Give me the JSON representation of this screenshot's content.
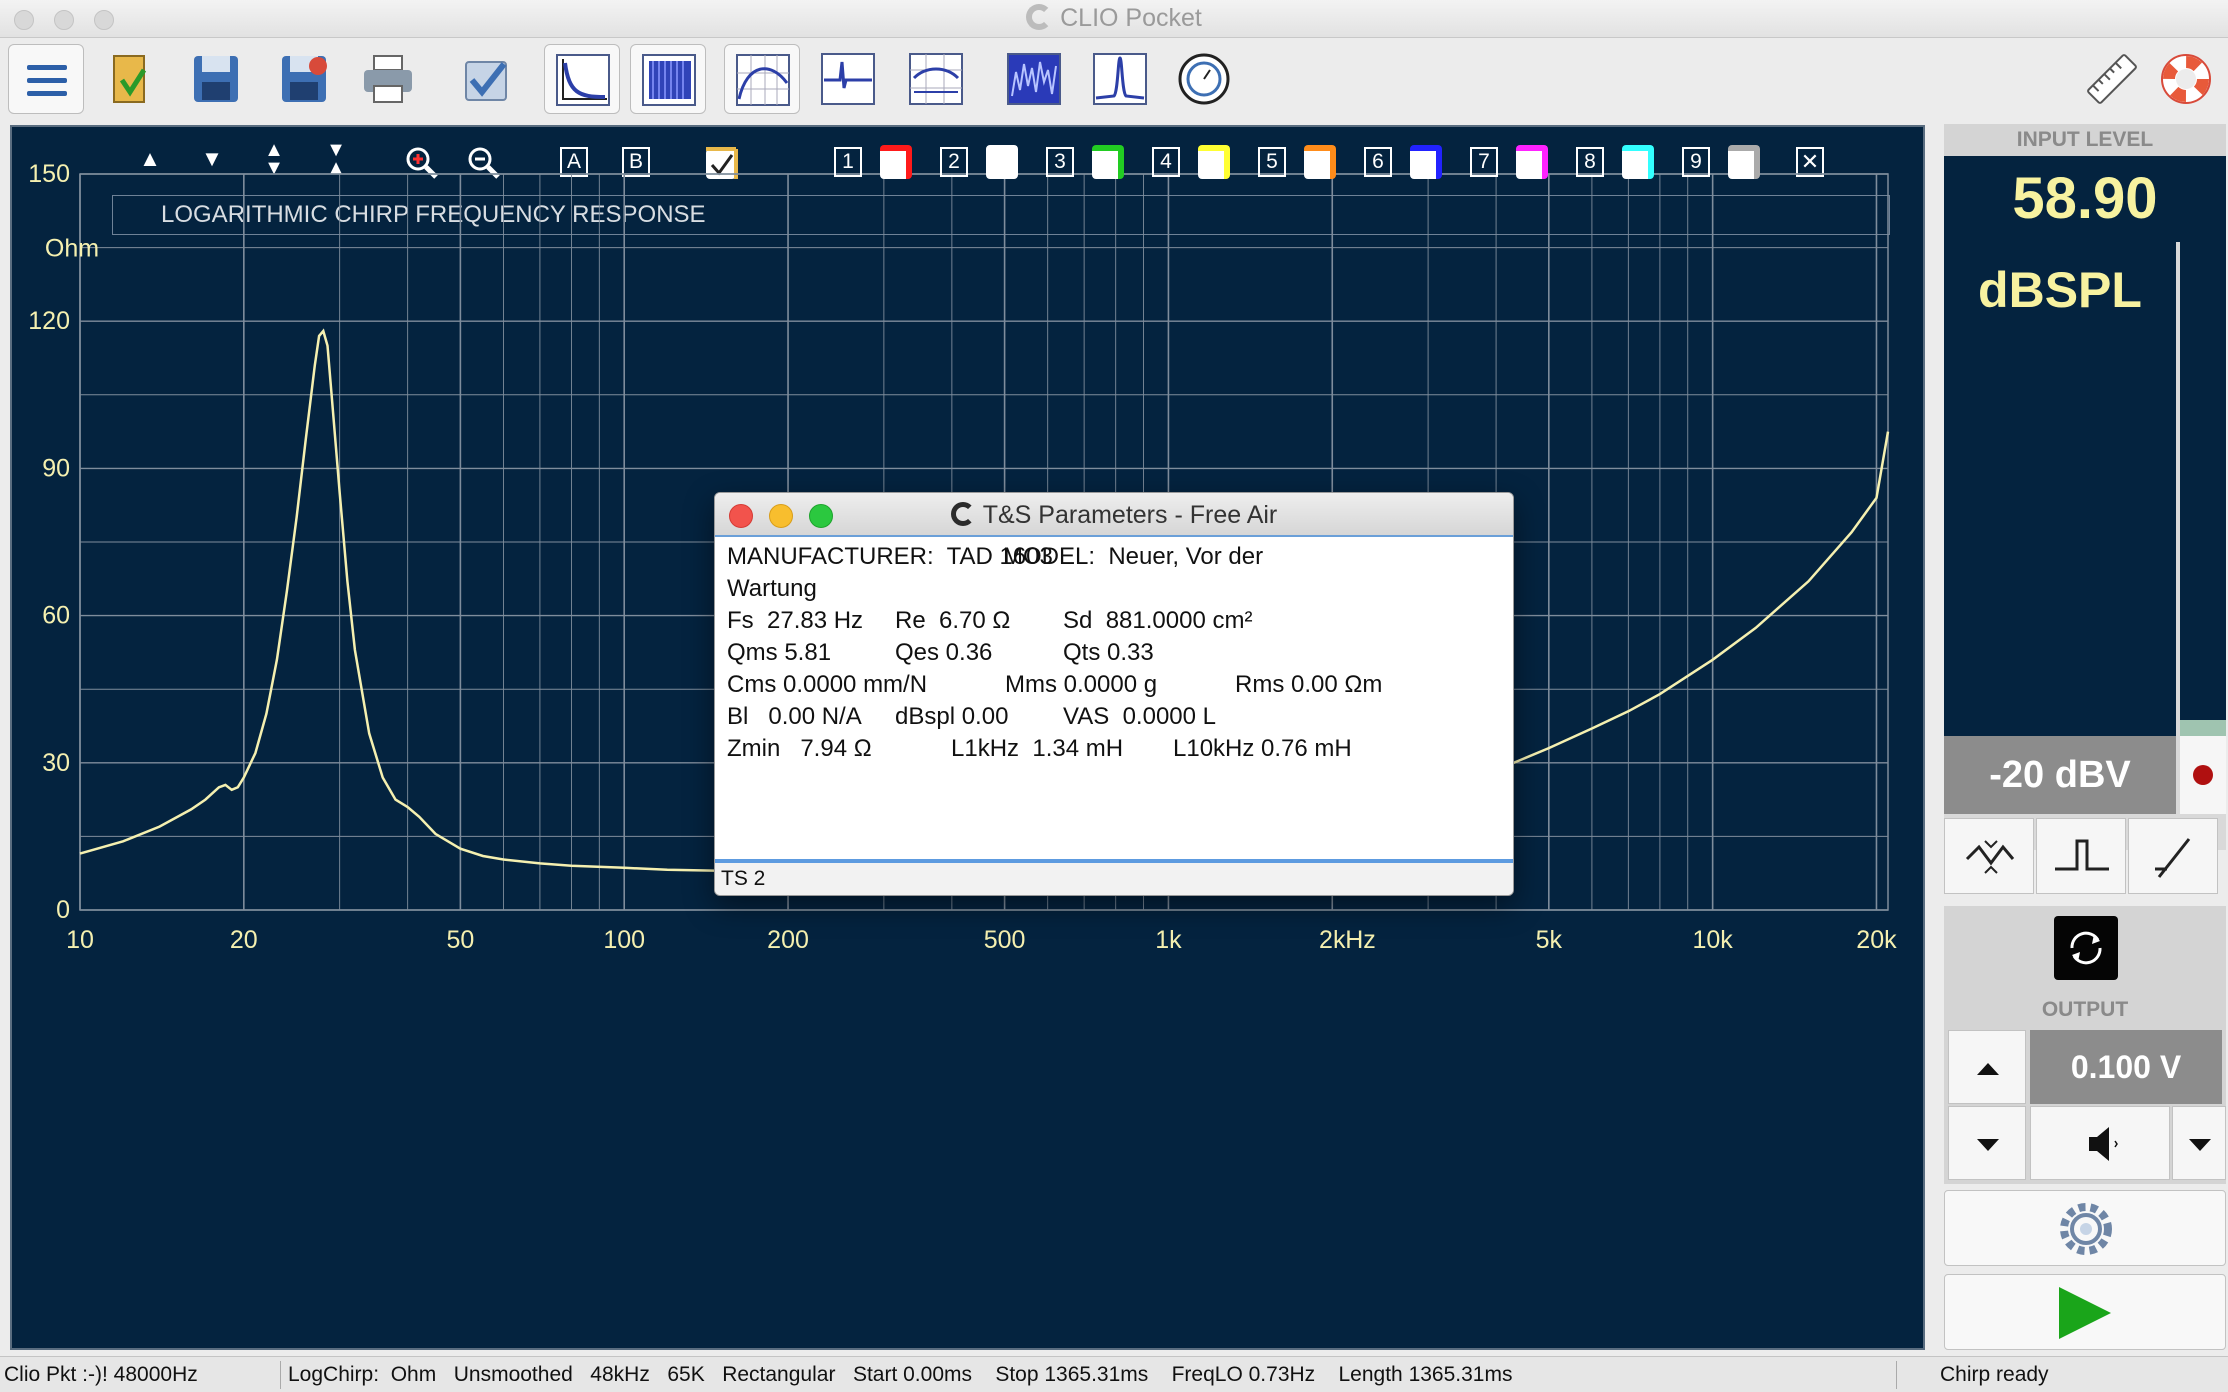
{
  "window": {
    "title": "CLIO Pocket"
  },
  "toolbar": {
    "icons": [
      "menu-icon",
      "open-file-icon",
      "save-icon",
      "save-as-icon",
      "print-icon",
      "checklist-icon",
      "chirp-response-icon",
      "waterfall-icon",
      "frequency-response-icon",
      "impulse-icon",
      "scope-icon",
      "spectrogram-icon",
      "narrow-peak-icon",
      "meter-dial-icon",
      "ruler-icon",
      "help-lifebuoy-icon"
    ]
  },
  "graph": {
    "tools": {
      "a_label": "A",
      "b_label": "B",
      "close_label": "✕"
    },
    "overlays": [
      {
        "num": "1",
        "color": "#ff1a1a"
      },
      {
        "num": "2",
        "color": "#ffffff"
      },
      {
        "num": "3",
        "color": "#22cc22"
      },
      {
        "num": "4",
        "color": "#ffff33"
      },
      {
        "num": "5",
        "color": "#ff8c1a"
      },
      {
        "num": "6",
        "color": "#2222ff"
      },
      {
        "num": "7",
        "color": "#ff22ff"
      },
      {
        "num": "8",
        "color": "#33ffff"
      },
      {
        "num": "9",
        "color": "#aaaaaa"
      }
    ],
    "colors": {
      "background": "#04233f",
      "grid": "#7f8d9c",
      "curve": "#f5f0b0",
      "tick_text": "#f5f0b0"
    }
  },
  "chart_data": {
    "type": "line",
    "title": "LOGARITHMIC CHIRP FREQUENCY RESPONSE",
    "xlabel": "Hz",
    "ylabel": "Ohm",
    "xscale": "log",
    "xlim": [
      10,
      21000
    ],
    "ylim": [
      0,
      150
    ],
    "x_ticks": [
      {
        "v": 10,
        "label": "10"
      },
      {
        "v": 20,
        "label": "20"
      },
      {
        "v": 50,
        "label": "50"
      },
      {
        "v": 100,
        "label": "100"
      },
      {
        "v": 200,
        "label": "200"
      },
      {
        "v": 500,
        "label": "500"
      },
      {
        "v": 1000,
        "label": "1k"
      },
      {
        "v": 2000,
        "label": "2k"
      },
      {
        "v": 5000,
        "label": "5k"
      },
      {
        "v": 10000,
        "label": "10k"
      },
      {
        "v": 20000,
        "label": "20k"
      }
    ],
    "y_ticks": [
      {
        "v": 0,
        "label": "0"
      },
      {
        "v": 30,
        "label": "30"
      },
      {
        "v": 60,
        "label": "60"
      },
      {
        "v": 90,
        "label": "90"
      },
      {
        "v": 120,
        "label": "120"
      },
      {
        "v": 150,
        "label": "150"
      }
    ],
    "grid": true,
    "series": [
      {
        "x": [
          10,
          12,
          14,
          16,
          17,
          18,
          18.5,
          19,
          19.5,
          20,
          21,
          22,
          23,
          24,
          25,
          26,
          27,
          27.5,
          28,
          28.5,
          29,
          30,
          31,
          32,
          34,
          36,
          38,
          40,
          42,
          45,
          50,
          55,
          60,
          70,
          80,
          100,
          120,
          150,
          200,
          250,
          300,
          400,
          500,
          600,
          700,
          800,
          1000,
          1200,
          1500,
          2000,
          2500,
          3000,
          4000,
          5000,
          6000,
          7000,
          8000,
          10000,
          12000,
          15000,
          18000,
          20000,
          21000
        ],
        "y": [
          11.5,
          14,
          17,
          20.5,
          22.5,
          25,
          25.5,
          24.5,
          25,
          27,
          32,
          40,
          51,
          65,
          80,
          96,
          111,
          117,
          118,
          115,
          105,
          85,
          67,
          53,
          36,
          27,
          22.5,
          21,
          19,
          15.5,
          12.5,
          11,
          10.3,
          9.5,
          9.0,
          8.6,
          8.2,
          8.0,
          8.3,
          9.0,
          9.5,
          10,
          11,
          12,
          12.5,
          13,
          14,
          15,
          16.5,
          19,
          21.5,
          24,
          28.5,
          33,
          37,
          40.5,
          44,
          51,
          57.5,
          67,
          77,
          84,
          97.5
        ]
      }
    ]
  },
  "dialog": {
    "title": "T&S Parameters - Free Air",
    "lines": [
      [
        {
          "t": "MANUFACTURER:  TAD 1603",
          "x": 0
        },
        {
          "t": "MODEL:  Neuer, Vor der",
          "x": 276
        }
      ],
      [
        {
          "t": "Wartung",
          "x": 0
        }
      ],
      [
        {
          "t": "Fs  27.83 Hz",
          "x": 0
        },
        {
          "t": "Re  6.70 Ω",
          "x": 168
        },
        {
          "t": "Sd  881.0000 cm²",
          "x": 336
        }
      ],
      [
        {
          "t": "Qms 5.81",
          "x": 0
        },
        {
          "t": "Qes 0.36",
          "x": 168
        },
        {
          "t": "Qts 0.33",
          "x": 336
        }
      ],
      [
        {
          "t": "Cms 0.0000 mm/N",
          "x": 0
        },
        {
          "t": "Mms 0.0000 g",
          "x": 278
        },
        {
          "t": "Rms 0.00 Ωm",
          "x": 508
        }
      ],
      [
        {
          "t": "Bl   0.00 N/A",
          "x": 0
        },
        {
          "t": "dBspl 0.00",
          "x": 168
        },
        {
          "t": "VAS  0.0000 L",
          "x": 336
        }
      ],
      [
        {
          "t": "Zmin   7.94 Ω",
          "x": 0
        },
        {
          "t": "L1kHz  1.34 mH",
          "x": 224
        },
        {
          "t": "L10kHz 0.76 mH",
          "x": 446
        }
      ]
    ],
    "footer": "TS 2"
  },
  "input_level": {
    "header": "INPUT LEVEL",
    "value": "58.90",
    "unit": "dBSPL",
    "sensitivity": "-20 dBV"
  },
  "output": {
    "header": "OUTPUT",
    "value": "0.100 V"
  },
  "statusbar": {
    "device": "Clio Pkt :-)! 48000Hz",
    "measurement": "LogChirp:  Ohm   Unsmoothed   48kHz   65K   Rectangular   Start 0.00ms    Stop 1365.31ms    FreqLO 0.73Hz    Length 1365.31ms",
    "state": "Chirp ready"
  }
}
